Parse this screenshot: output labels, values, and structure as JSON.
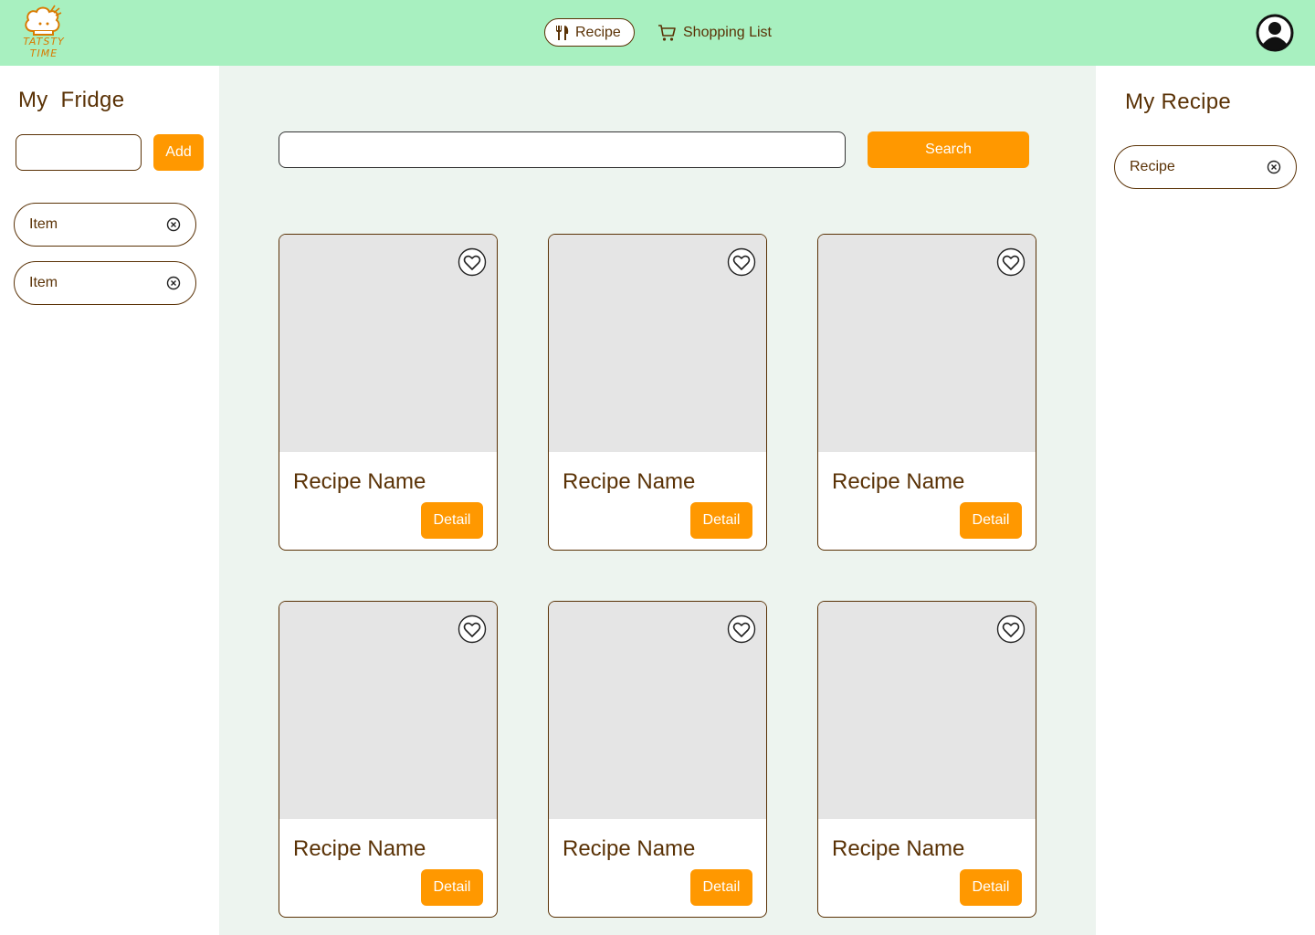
{
  "header": {
    "logo": {
      "line1": "TATSTY",
      "line2": "TIME"
    },
    "nav": {
      "recipe_label": "Recipe",
      "recipe_icon": "utensils-icon",
      "shopping_label": "Shopping List",
      "shopping_icon": "cart-icon"
    },
    "profile_icon": "user-circle-icon"
  },
  "fridge": {
    "title": "My  Fridge",
    "input_value": "",
    "add_label": "Add",
    "items": [
      {
        "label": "Item"
      },
      {
        "label": "Item"
      }
    ]
  },
  "main": {
    "search_value": "",
    "search_label": "Search",
    "cards": [
      {
        "name": "Recipe Name",
        "detail_label": "Detail"
      },
      {
        "name": "Recipe Name",
        "detail_label": "Detail"
      },
      {
        "name": "Recipe Name",
        "detail_label": "Detail"
      },
      {
        "name": "Recipe Name",
        "detail_label": "Detail"
      },
      {
        "name": "Recipe Name",
        "detail_label": "Detail"
      },
      {
        "name": "Recipe Name",
        "detail_label": "Detail"
      }
    ]
  },
  "my_recipe": {
    "title": "My Recipe",
    "items": [
      {
        "label": "Recipe"
      }
    ]
  },
  "colors": {
    "header_bg": "#a8f0c0",
    "main_bg": "#edf4ef",
    "accent": "#ff9800",
    "text_brown": "#5a3206",
    "image_placeholder": "#e5e5e5"
  }
}
